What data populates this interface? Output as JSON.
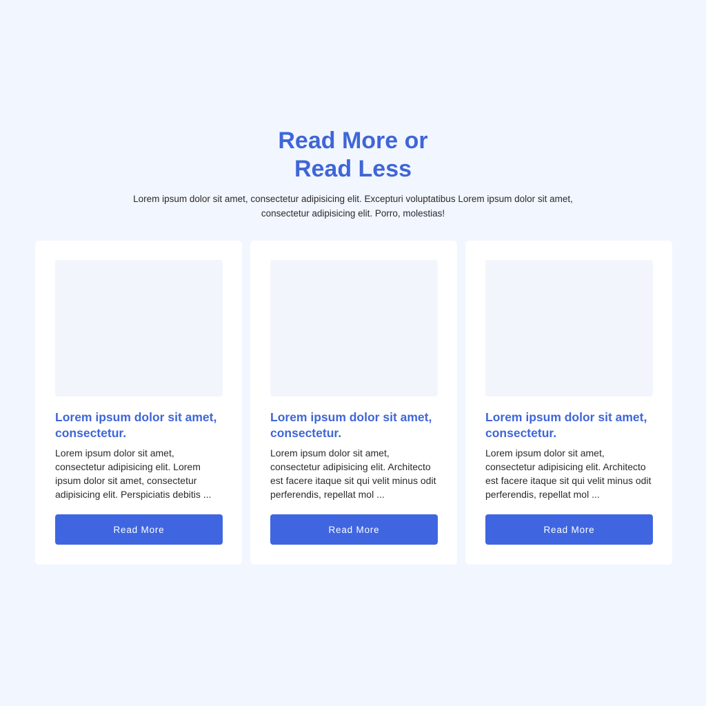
{
  "heading": {
    "line1": "Read More or",
    "line2": "Read Less"
  },
  "intro": "Lorem ipsum dolor sit amet, consectetur adipisicing elit. Excepturi voluptatibus Lorem ipsum dolor sit amet, consectetur adipisicing elit. Porro, molestias!",
  "colors": {
    "accent": "#3f66d8",
    "button": "#3f66e0",
    "background": "#f2f6fe",
    "card": "#ffffff",
    "image_placeholder": "#f2f5fc"
  },
  "cards": [
    {
      "title": "Lorem ipsum dolor sit amet, consectetur.",
      "text": "Lorem ipsum dolor sit amet, consectetur adipisicing elit. Lorem ipsum dolor sit amet, consectetur adipisicing elit. Perspiciatis debitis ...",
      "button": "Read More"
    },
    {
      "title": "Lorem ipsum dolor sit amet, consectetur.",
      "text": "Lorem ipsum dolor sit amet, consectetur adipisicing elit. Architecto est facere itaque sit qui velit minus odit perferendis, repellat mol ...",
      "button": "Read More"
    },
    {
      "title": "Lorem ipsum dolor sit amet, consectetur.",
      "text": "Lorem ipsum dolor sit amet, consectetur adipisicing elit. Architecto est facere itaque sit qui velit minus odit perferendis, repellat mol ...",
      "button": "Read More"
    }
  ]
}
